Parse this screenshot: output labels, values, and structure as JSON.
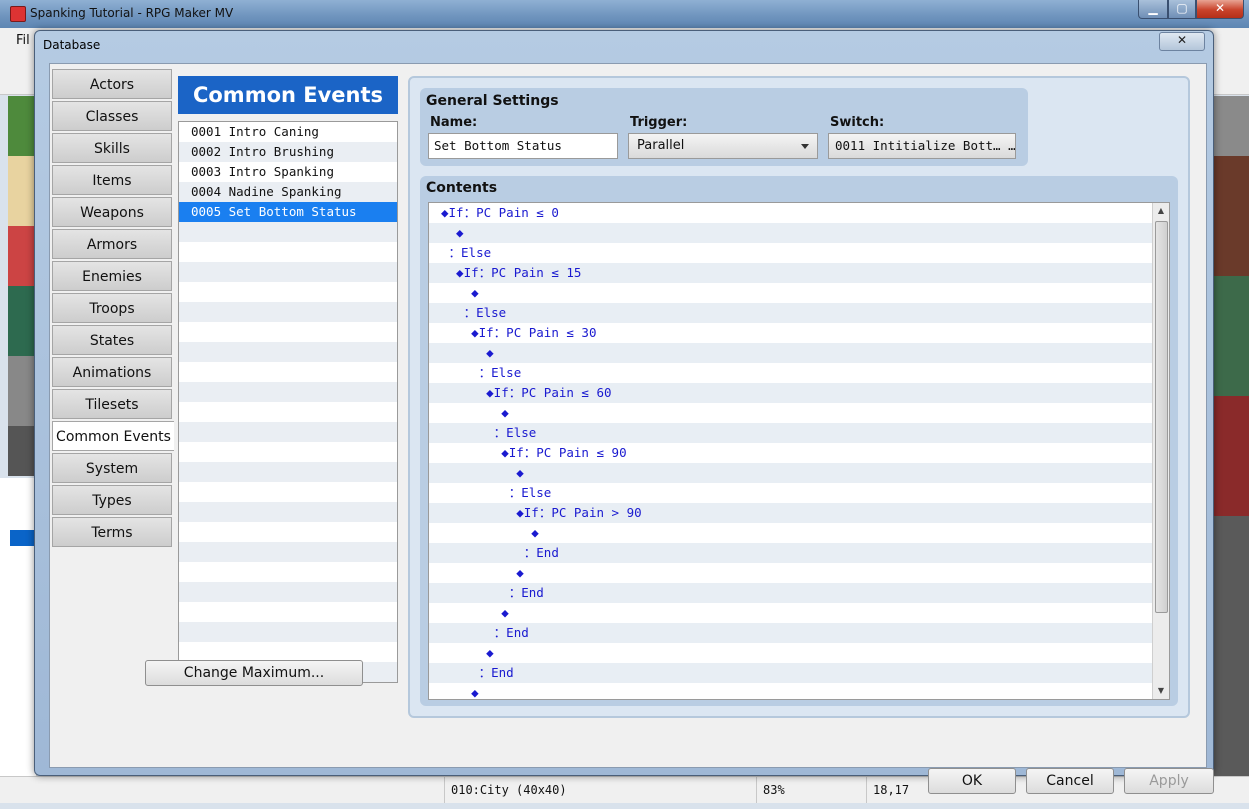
{
  "main_window": {
    "title": "Spanking Tutorial - RPG Maker MV",
    "menu_file": "Fil",
    "controls": {
      "minimize": "▁",
      "maximize": "▢",
      "close": "✕"
    }
  },
  "dialog": {
    "title": "Database",
    "close_label": "✕"
  },
  "tabs": [
    {
      "label": "Actors"
    },
    {
      "label": "Classes"
    },
    {
      "label": "Skills"
    },
    {
      "label": "Items"
    },
    {
      "label": "Weapons"
    },
    {
      "label": "Armors"
    },
    {
      "label": "Enemies"
    },
    {
      "label": "Troops"
    },
    {
      "label": "States"
    },
    {
      "label": "Animations"
    },
    {
      "label": "Tilesets"
    },
    {
      "label": "Common Events",
      "active": true
    },
    {
      "label": "System"
    },
    {
      "label": "Types"
    },
    {
      "label": "Terms"
    }
  ],
  "common_events": {
    "header": "Common Events",
    "items": [
      "0001 Intro Caning",
      "0002 Intro Brushing",
      "0003 Intro Spanking",
      "0004 Nadine Spanking",
      "0005 Set Bottom Status"
    ],
    "selected_index": 4,
    "change_max_label": "Change Maximum..."
  },
  "general_settings": {
    "title": "General Settings",
    "name_label": "Name:",
    "name_value": "Set Bottom Status",
    "trigger_label": "Trigger:",
    "trigger_value": "Parallel",
    "switch_label": "Switch:",
    "switch_value": "0011 Intitialize Bott… …"
  },
  "contents": {
    "title": "Contents",
    "lines": [
      "◆If：PC Pain ≤ 0",
      "  ◆",
      " ：Else",
      "  ◆If：PC Pain ≤ 15",
      "    ◆",
      "   ：Else",
      "    ◆If：PC Pain ≤ 30",
      "      ◆",
      "     ：Else",
      "      ◆If：PC Pain ≤ 60",
      "        ◆",
      "       ：Else",
      "        ◆If：PC Pain ≤ 90",
      "          ◆",
      "         ：Else",
      "          ◆If：PC Pain > 90",
      "            ◆",
      "           ：End",
      "          ◆",
      "         ：End",
      "        ◆",
      "       ：End",
      "      ◆",
      "     ：End",
      "    ◆"
    ]
  },
  "footer": {
    "ok_label": "OK",
    "cancel_label": "Cancel",
    "apply_label": "Apply"
  },
  "statusbar": {
    "map": "010:City (40x40)",
    "zoom": "83%",
    "coords": "18,17"
  }
}
